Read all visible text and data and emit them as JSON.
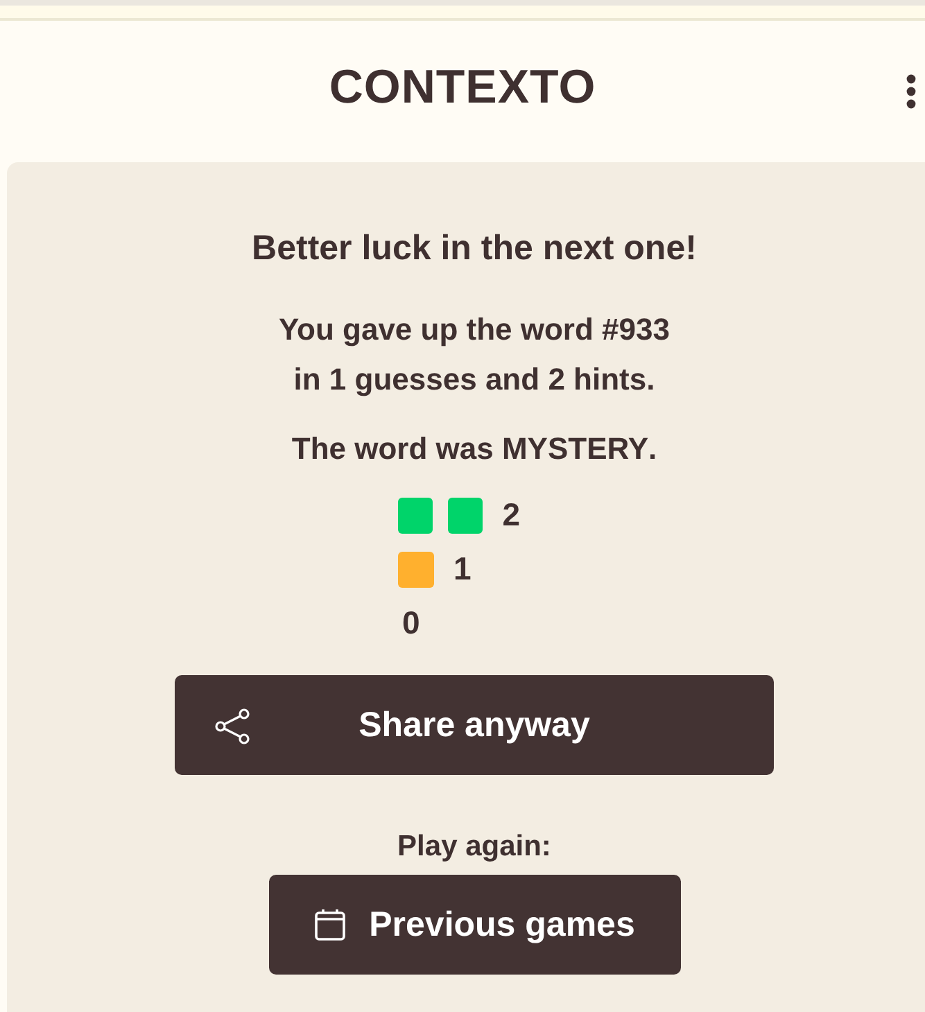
{
  "header": {
    "title": "CONTEXTO"
  },
  "result": {
    "heading": "Better luck in the next one!",
    "summary": "You gave up the word **#933**\nin **1** guesses and **2** hints.",
    "answer": "The word was **MYSTERY**.",
    "distribution": [
      {
        "squares": [
          {
            "color": "#00d46a"
          },
          {
            "color": "#00d46a"
          }
        ],
        "count": "2"
      },
      {
        "squares": [
          {
            "color": "#ffb02e"
          }
        ],
        "count": "1"
      },
      {
        "count": "0"
      }
    ],
    "share_button": "Share anyway",
    "play_again_label": "Play again:",
    "previous_games_button": "Previous games"
  }
}
